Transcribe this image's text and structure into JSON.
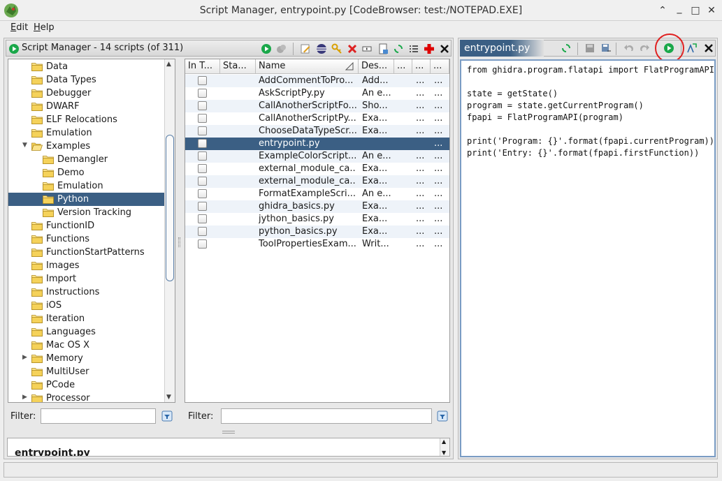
{
  "window": {
    "title": "Script Manager, entrypoint.py [CodeBrowser: test:/NOTEPAD.EXE]",
    "minimize": "⌃",
    "restore": "_",
    "maximize": "□",
    "close": "✕"
  },
  "menu": {
    "edit_prefix": "E",
    "edit_rest": "dit",
    "help_prefix": "H",
    "help_rest": "elp"
  },
  "script_manager": {
    "title": "Script Manager - 14 scripts  (of 311)"
  },
  "tree": [
    {
      "label": "Data",
      "indent": 0
    },
    {
      "label": "Data Types",
      "indent": 0
    },
    {
      "label": "Debugger",
      "indent": 0
    },
    {
      "label": "DWARF",
      "indent": 0
    },
    {
      "label": "ELF Relocations",
      "indent": 0
    },
    {
      "label": "Emulation",
      "indent": 0
    },
    {
      "label": "Examples",
      "indent": 0,
      "expanded": true
    },
    {
      "label": "Demangler",
      "indent": 1
    },
    {
      "label": "Demo",
      "indent": 1
    },
    {
      "label": "Emulation",
      "indent": 1
    },
    {
      "label": "Python",
      "indent": 1,
      "selected": true
    },
    {
      "label": "Version Tracking",
      "indent": 1
    },
    {
      "label": "FunctionID",
      "indent": 0
    },
    {
      "label": "Functions",
      "indent": 0
    },
    {
      "label": "FunctionStartPatterns",
      "indent": 0
    },
    {
      "label": "Images",
      "indent": 0
    },
    {
      "label": "Import",
      "indent": 0
    },
    {
      "label": "Instructions",
      "indent": 0
    },
    {
      "label": "iOS",
      "indent": 0
    },
    {
      "label": "Iteration",
      "indent": 0
    },
    {
      "label": "Languages",
      "indent": 0
    },
    {
      "label": "Mac OS X",
      "indent": 0
    },
    {
      "label": "Memory",
      "indent": 0,
      "collapsed": true
    },
    {
      "label": "MultiUser",
      "indent": 0
    },
    {
      "label": "PCode",
      "indent": 0
    },
    {
      "label": "Processor",
      "indent": 0,
      "collapsed": true
    }
  ],
  "table": {
    "headers": [
      "In T...",
      "Sta...",
      "Name",
      "Des...",
      "...",
      "...",
      "..."
    ],
    "rows": [
      {
        "name": "AddCommentToPro...",
        "desc": "Add...",
        "c5": "...",
        "c6": "..."
      },
      {
        "name": "AskScriptPy.py",
        "desc": "An e...",
        "c5": "...",
        "c6": "..."
      },
      {
        "name": "CallAnotherScriptFo...",
        "desc": "Sho...",
        "c5": "...",
        "c6": "..."
      },
      {
        "name": "CallAnotherScriptPy....",
        "desc": "Exa...",
        "c5": "...",
        "c6": "..."
      },
      {
        "name": "ChooseDataTypeScr...",
        "desc": "Exa...",
        "c5": "...",
        "c6": "..."
      },
      {
        "name": "entrypoint.py",
        "desc": "",
        "c5": "",
        "c6": "...",
        "selected": true
      },
      {
        "name": "ExampleColorScript...",
        "desc": "An e...",
        "c5": "...",
        "c6": "..."
      },
      {
        "name": "external_module_ca...",
        "desc": "Exa...",
        "c5": "...",
        "c6": "..."
      },
      {
        "name": "external_module_ca...",
        "desc": "Exa...",
        "c5": "...",
        "c6": "..."
      },
      {
        "name": "FormatExampleScri...",
        "desc": "An e...",
        "c5": "...",
        "c6": "..."
      },
      {
        "name": "ghidra_basics.py",
        "desc": "Exa...",
        "c5": "...",
        "c6": "..."
      },
      {
        "name": "jython_basics.py",
        "desc": "Exa...",
        "c5": "...",
        "c6": "..."
      },
      {
        "name": "python_basics.py",
        "desc": "Exa...",
        "c5": "...",
        "c6": "..."
      },
      {
        "name": "ToolPropertiesExam...",
        "desc": "Writ...",
        "c5": "...",
        "c6": "..."
      }
    ]
  },
  "filters": {
    "tree_label": "Filter:",
    "table_label": "Filter:"
  },
  "description": {
    "text": "entrypoint.py"
  },
  "editor": {
    "tab_label": "entrypoint.py",
    "code": [
      "from ghidra.program.flatapi import FlatProgramAPI",
      "",
      "state = getState()",
      "program = state.getCurrentProgram()",
      "fpapi = FlatProgramAPI(program)",
      "",
      "print('Program: {}'.format(fpapi.currentProgram))",
      "print('Entry: {}'.format(fpapi.firstFunction))"
    ]
  },
  "colors": {
    "selection": "#3b5f84",
    "run_green": "#1aa84a",
    "highlight_circle": "#e02020"
  }
}
